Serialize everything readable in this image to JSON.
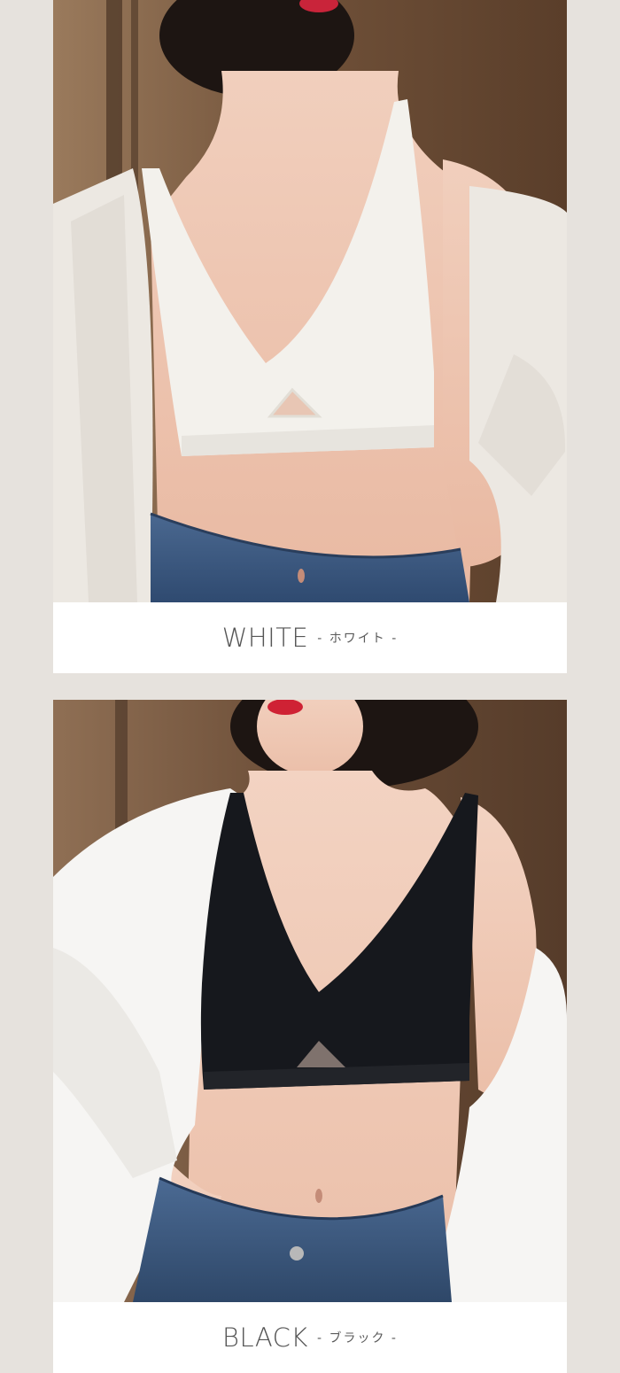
{
  "products": [
    {
      "color_name": "WHITE",
      "color_name_jp": "- ホワイト -",
      "bra_color": "#f3f1ec",
      "shirt_color": "#ece8e2"
    },
    {
      "color_name": "BLACK",
      "color_name_jp": "- ブラック -",
      "bra_color": "#16181d",
      "shirt_color": "#f6f5f3"
    }
  ],
  "colors": {
    "page_background": "#e6e2dd",
    "caption_text": "#555555",
    "skin": "#f0c9b4",
    "denim": "#3d5a82",
    "wall_wood": "#7a5a3e"
  }
}
